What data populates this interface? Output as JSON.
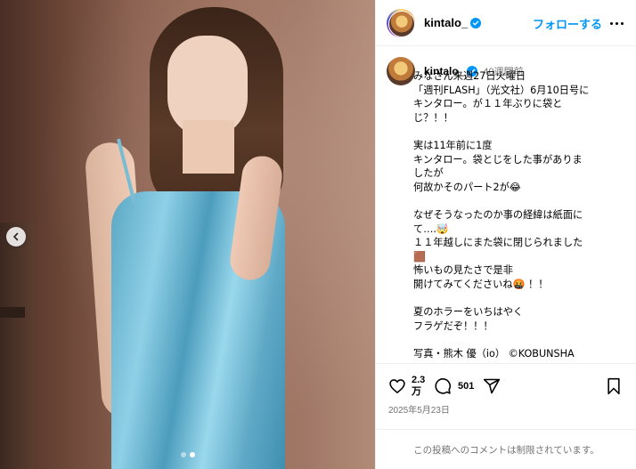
{
  "header": {
    "username": "kintalo_",
    "follow_label": "フォローする"
  },
  "caption": {
    "username": "kintalo_",
    "time_ago": "40週間前",
    "lines": [
      "みなさん来週27日火曜日",
      "「週刊FLASH」（光文社）6月10日号に",
      "キンタロー。が１１年ぶりに袋と",
      "じ？！！",
      "",
      "実は11年前に1度",
      "キンタロー。袋とじをした事がありま",
      "したが",
      "何故かそのパート2が😂",
      "",
      "なぜそうなったのか事の経緯は紙面に",
      "て….🤯",
      "１１年越しにまた袋に閉じられました",
      "🟫",
      "怖いもの見たさで是非",
      "開けてみてくださいね🤬 ！！",
      "",
      "夏のホラーをいちはやく",
      "フラゲだぞ！！！",
      "",
      "写真・熊木 優（io） ©KOBUNSHA"
    ]
  },
  "actions": {
    "likes_line1": "2.3",
    "likes_line2": "万",
    "comments": "501",
    "date": "2025年5月23日"
  },
  "footer": {
    "comments_disabled": "この投稿へのコメントは制限されています。"
  },
  "carousel": {
    "total": 2,
    "current": 2
  },
  "colors": {
    "accent": "#0095f6",
    "verified": "#0095f6",
    "muted": "#737373",
    "dress": "#5aa7c4"
  },
  "icons": {
    "like": "heart-icon",
    "comment": "comment-icon",
    "share": "paper-plane-icon",
    "save": "bookmark-icon",
    "more": "more-dots-icon",
    "prev": "chevron-left-icon",
    "verified": "verified-badge-icon"
  }
}
